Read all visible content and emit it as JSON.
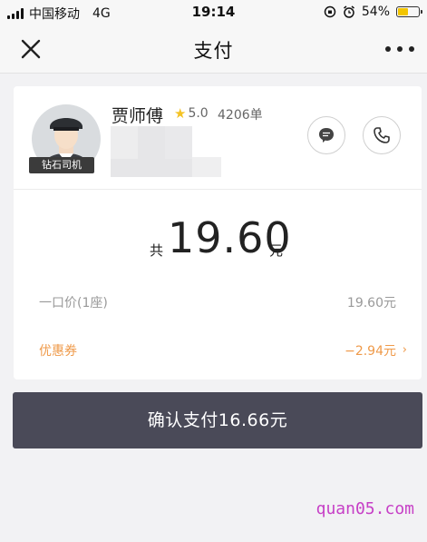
{
  "status_bar": {
    "carrier": "中国移动",
    "network": "4G",
    "time": "19:14",
    "battery_percent": "54%",
    "battery_level": 0.54
  },
  "nav": {
    "title": "支付"
  },
  "driver": {
    "name": "贾师傅",
    "rating": "5.0",
    "orders": "4206单",
    "badge": "钻石司机"
  },
  "fare": {
    "prefix": "共",
    "amount": "19.60",
    "unit": "元",
    "rows": [
      {
        "label": "一口价(1座)",
        "value": "19.60元"
      },
      {
        "label": "优惠券",
        "value": "−2.94元"
      }
    ]
  },
  "pay_button": {
    "label": "确认支付16.66元"
  },
  "watermark": "quan05.com",
  "colors": {
    "accent_orange": "#ef9a4a",
    "button_bg": "#4a4a58",
    "star": "#f4c325"
  }
}
